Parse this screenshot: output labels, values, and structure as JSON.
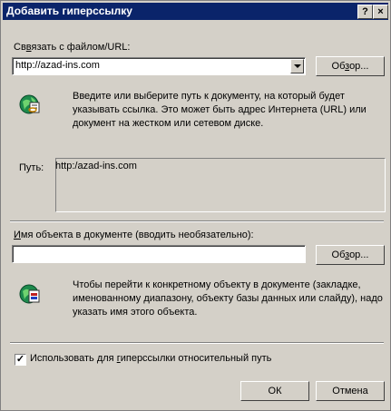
{
  "dialog": {
    "title": "Добавить гиперссылку",
    "help_glyph": "?",
    "close_glyph": "×"
  },
  "link": {
    "label_u": "в",
    "label_pre": "Св",
    "label_post": "язать с файлом/URL:",
    "value": "http://azad-ins.com",
    "browse_pre": "Об",
    "browse_u": "з",
    "browse_post": "ор...",
    "help_text": "Введите или выберите путь к документу, на который будет указывать ссылка.  Это может быть адрес Интернета (URL) или документ на жестком или сетевом диске."
  },
  "path": {
    "label": "Путь:",
    "value": "http:/azad-ins.com"
  },
  "anchor": {
    "label_u": "И",
    "label_post": "мя объекта в документе (вводить необязательно):",
    "value": "",
    "browse_pre": "Об",
    "browse_u": "з",
    "browse_post": "ор...",
    "help_text": "Чтобы перейти к конкретному объекту в документе (закладке, именованному диапазону, объекту базы данных или слайду), надо указать имя этого объекта."
  },
  "relative": {
    "checked": true,
    "check_glyph": "✓",
    "label_pre": "Использовать для ",
    "label_u": "г",
    "label_post": "иперссылки относительный путь"
  },
  "buttons": {
    "ok": "ОК",
    "cancel": "Отмена"
  }
}
